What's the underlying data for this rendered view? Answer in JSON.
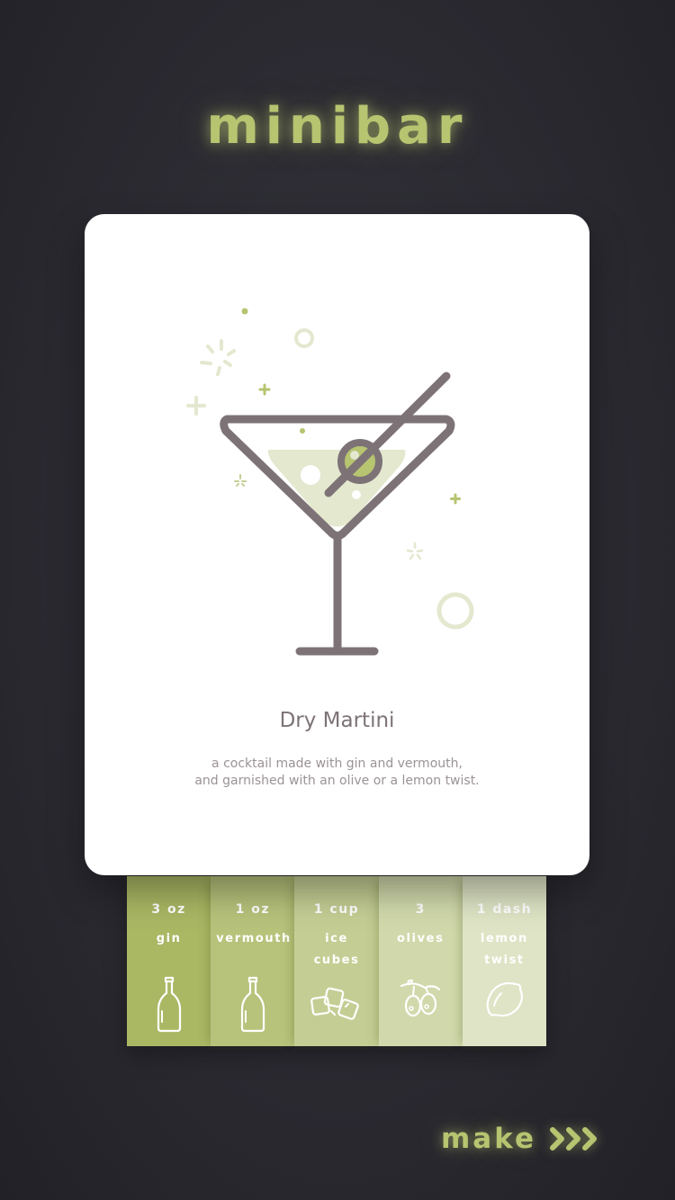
{
  "app": {
    "title": "minibar"
  },
  "drink": {
    "name": "Dry Martini",
    "description_lines": [
      "a cocktail made with gin and vermouth,",
      "and garnished with an olive or a lemon twist."
    ]
  },
  "ingredients": [
    {
      "amount": "3 oz",
      "name_lines": [
        "gin"
      ],
      "icon": "bottle-icon",
      "color": "#aab864"
    },
    {
      "amount": "1 oz",
      "name_lines": [
        "vermouth"
      ],
      "icon": "bottle-icon",
      "color": "#b7c37b"
    },
    {
      "amount": "1 cup",
      "name_lines": [
        "ice",
        "cubes"
      ],
      "icon": "ice-cubes-icon",
      "color": "#c4ce94"
    },
    {
      "amount": "3",
      "name_lines": [
        "olives"
      ],
      "icon": "olives-icon",
      "color": "#d1d9ac"
    },
    {
      "amount": "1 dash",
      "name_lines": [
        "lemon",
        "twist"
      ],
      "icon": "lemon-icon",
      "color": "#dee4c5"
    }
  ],
  "actions": {
    "make_label": "make",
    "make_icon": "triple-chevron-right-icon"
  },
  "colors": {
    "accent": "#b7c470",
    "glass": "#7d7376",
    "liquid": "#e3e8cf",
    "background": "#2b2a31"
  }
}
